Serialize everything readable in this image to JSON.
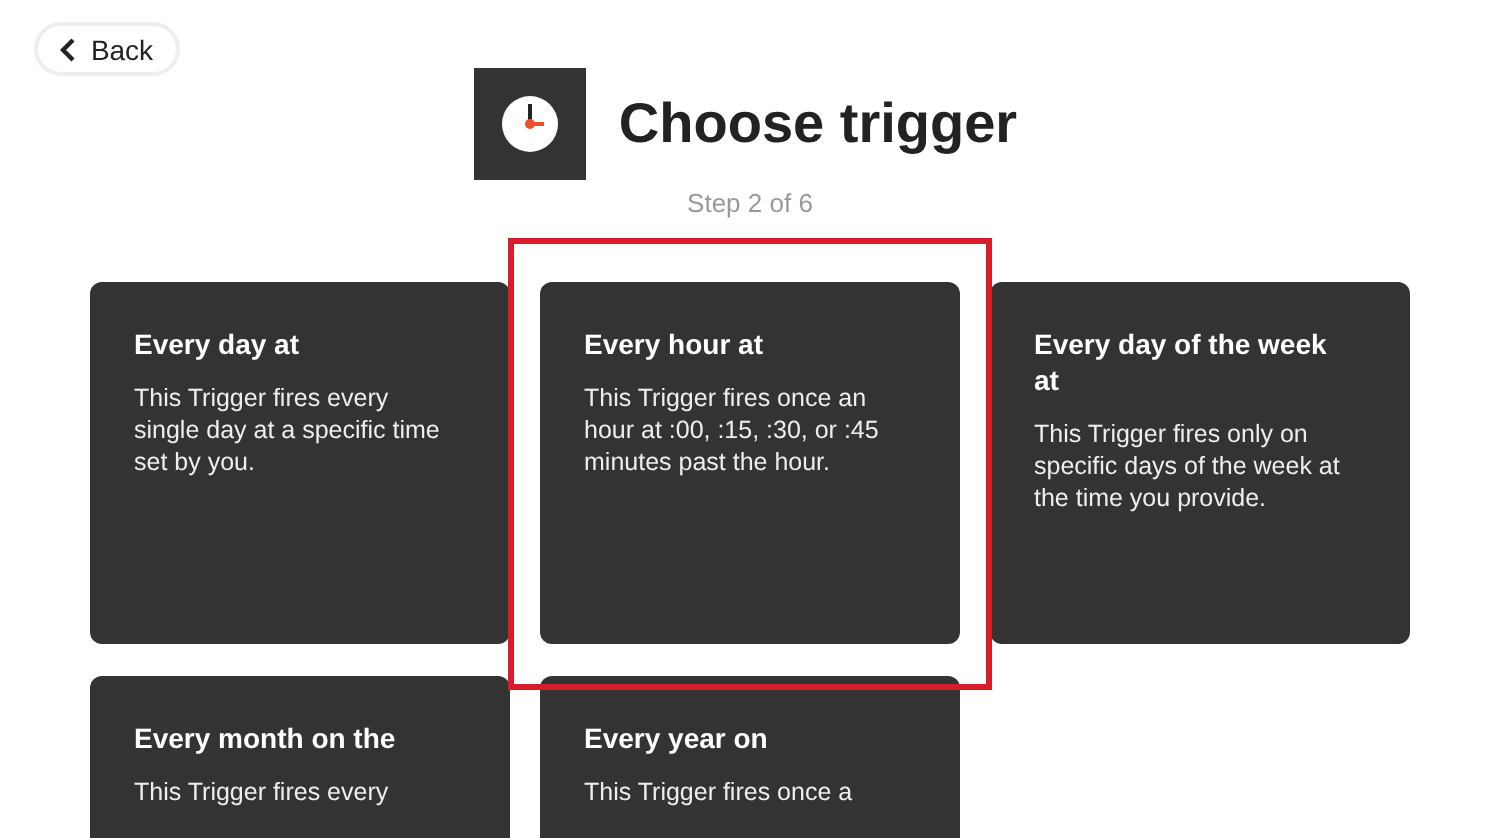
{
  "back_button": {
    "label": "Back"
  },
  "header": {
    "title": "Choose trigger",
    "step": "Step 2 of 6"
  },
  "triggers": [
    {
      "title": "Every day at",
      "description": "This Trigger fires every single day at a specific time set by you.",
      "selected": false
    },
    {
      "title": "Every hour at",
      "description": "This Trigger fires once an hour at :00, :15, :30, or :45 minutes past the hour.",
      "selected": true
    },
    {
      "title": "Every day of the week at",
      "description": "This Trigger fires only on specific days of the week at the time you provide.",
      "selected": false
    },
    {
      "title": "Every month on the",
      "description": "This Trigger fires every",
      "selected": false
    },
    {
      "title": "Every year on",
      "description": "This Trigger fires once a",
      "selected": false
    }
  ]
}
